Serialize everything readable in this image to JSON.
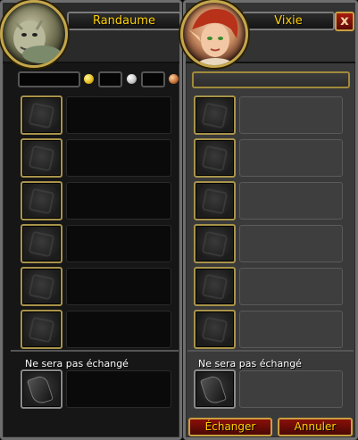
{
  "player": {
    "name": "Randaume",
    "portrait": "undead-character-portrait",
    "money_coins": [
      "gold-coin-icon",
      "silver-coin-icon",
      "copper-coin-icon"
    ],
    "not_traded_label": "Ne sera pas échangé"
  },
  "target": {
    "name": "Vixie",
    "portrait": "blood-elf-character-portrait",
    "not_traded_label": "Ne sera pas échangé"
  },
  "window": {
    "close_glyph": "x"
  },
  "buttons": {
    "trade_label": "Échanger",
    "cancel_label": "Annuler"
  },
  "colors": {
    "gold_text": "#ffd100",
    "gold": "#e8c020",
    "silver": "#c8c8c8",
    "copper": "#c8733a",
    "button_red": "#8a0f08"
  }
}
